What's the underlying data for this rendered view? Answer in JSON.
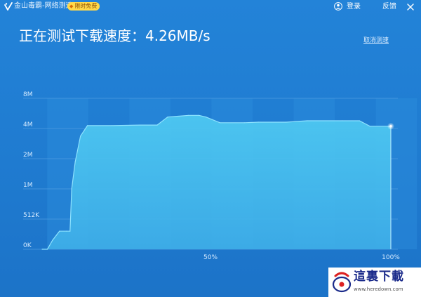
{
  "titlebar": {
    "app_title": "金山毒霸-网络测速",
    "badge_text": "限时免费",
    "login_label": "登录",
    "feedback_label": "反馈"
  },
  "headline": {
    "prefix": "正在测试下载速度：",
    "speed": "4.26MB/s"
  },
  "cancel_label": "取消测速",
  "chart_data": {
    "type": "area",
    "y_tick_labels": [
      "8M",
      "4M",
      "2M",
      "1M",
      "512K",
      "0K"
    ],
    "x_tick_labels": [
      "50%",
      "100%"
    ],
    "x_range": [
      0,
      100
    ],
    "y_scale": "log-like (ticks evenly spaced: 0K, 512K, 1M, 2M, 4M, 8M)",
    "grid": true,
    "series": [
      {
        "x": [
          0,
          1.5,
          3,
          5,
          7,
          8,
          8.5,
          9.5,
          11,
          13,
          20,
          28,
          33,
          36,
          42,
          45,
          47,
          51,
          58,
          62,
          70,
          76,
          86,
          91,
          94,
          100
        ],
        "level": [
          0,
          0,
          0.06,
          0.12,
          0.12,
          0.12,
          0.4,
          0.58,
          0.75,
          0.819,
          0.819,
          0.823,
          0.823,
          0.876,
          0.887,
          0.887,
          0.876,
          0.838,
          0.838,
          0.842,
          0.842,
          0.851,
          0.851,
          0.851,
          0.815,
          0.815
        ]
      }
    ],
    "colors": {
      "fill_top": "#4ec9f0",
      "fill_bottom": "#3fb1e8",
      "stroke": "#8fe3ff",
      "grid": "#4a9ae0"
    }
  },
  "watermark": {
    "name": "這裏下載",
    "url": "www.heredown.com"
  }
}
